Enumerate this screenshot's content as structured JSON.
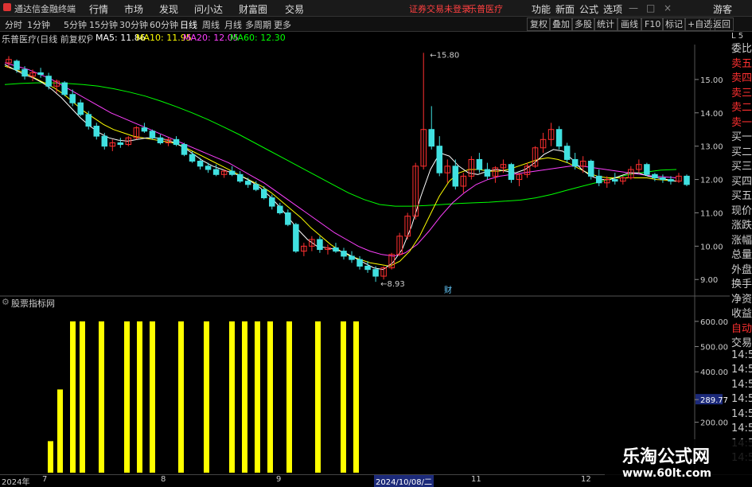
{
  "window": {
    "app_title": "通达信金融终端",
    "menus": [
      "行情",
      "市场",
      "发现",
      "问小达",
      "财富圈",
      "交易"
    ],
    "status_red": [
      "证券交易未登录",
      "乐普医疗"
    ],
    "right_menus": [
      "功能",
      "新面",
      "公式",
      "选项"
    ],
    "right_extra": "游客"
  },
  "toolbar": {
    "periods": [
      "分时",
      "1分钟",
      "5分钟",
      "15分钟",
      "30分钟",
      "60分钟",
      "日线",
      "周线",
      "月线",
      "多周期",
      "更多"
    ],
    "active": "日线",
    "right_buttons": [
      "复权",
      "叠加",
      "多股",
      "统计",
      "画线",
      "F10",
      "标记",
      "+自选",
      "返回"
    ]
  },
  "infobar": {
    "stock": "乐普医疗(日线 前复权)",
    "ma5": "MA5: 11.86",
    "ma10": "MA10: 11.95",
    "ma20": "MA20: 12.05",
    "ma60": "MA60: 12.30",
    "colors": {
      "ma5": "#ffffff",
      "ma10": "#ffff00",
      "ma20": "#ff40ff",
      "ma60": "#00ff00"
    }
  },
  "annotations": {
    "high": "15.80",
    "low": "8.93",
    "marker_cai": "财"
  },
  "price_axis": [
    "15.00",
    "14.00",
    "13.00",
    "12.00",
    "11.00",
    "10.00",
    "9.00"
  ],
  "indicator": {
    "title": "股票指标网",
    "axis": [
      "600.00",
      "500.00",
      "400.00",
      "289.77",
      "200.00"
    ],
    "current_label": "289.77"
  },
  "side_panel": {
    "top": "L 5",
    "items": [
      "委比",
      "卖五",
      "卖四",
      "卖三",
      "卖二",
      "卖一",
      "买一",
      "买二",
      "买三",
      "买四",
      "买五",
      "现价",
      "涨跌",
      "涨幅",
      "总量",
      "外盘",
      "换手",
      "净资",
      "收益",
      "自动",
      "交易",
      "14:5",
      "14:5",
      "14:5",
      "14:5",
      "14:5",
      "14:5",
      "14:5",
      "14:5"
    ]
  },
  "bottom_axis": {
    "labels": [
      "2024年",
      "7",
      "8",
      "9",
      "11",
      "12"
    ],
    "highlight": "2024/10/08/二"
  },
  "watermark": {
    "line1": "乐淘公式网",
    "line2": "www.60lt.com"
  },
  "chart_data": {
    "type": "candlestick",
    "price_range": [
      8.6,
      16.0
    ],
    "candles": [
      [
        15.5,
        15.7,
        15.35,
        15.6
      ],
      [
        15.55,
        15.6,
        15.2,
        15.3
      ],
      [
        15.3,
        15.4,
        15.0,
        15.1
      ],
      [
        15.1,
        15.3,
        14.95,
        15.2
      ],
      [
        15.2,
        15.35,
        15.05,
        15.15
      ],
      [
        15.1,
        15.2,
        14.7,
        14.8
      ],
      [
        14.8,
        15.0,
        14.6,
        14.95
      ],
      [
        14.9,
        14.95,
        14.5,
        14.55
      ],
      [
        14.55,
        14.7,
        14.2,
        14.3
      ],
      [
        14.3,
        14.4,
        13.9,
        13.95
      ],
      [
        13.95,
        14.05,
        13.5,
        13.6
      ],
      [
        13.6,
        13.7,
        13.2,
        13.3
      ],
      [
        13.3,
        13.4,
        12.9,
        13.0
      ],
      [
        13.0,
        13.2,
        12.85,
        13.1
      ],
      [
        13.1,
        13.25,
        12.95,
        13.05
      ],
      [
        13.05,
        13.3,
        13.0,
        13.25
      ],
      [
        13.25,
        13.6,
        13.2,
        13.55
      ],
      [
        13.55,
        13.7,
        13.4,
        13.45
      ],
      [
        13.45,
        13.5,
        13.2,
        13.25
      ],
      [
        13.25,
        13.35,
        13.05,
        13.1
      ],
      [
        13.1,
        13.25,
        13.0,
        13.2
      ],
      [
        13.2,
        13.3,
        13.0,
        13.05
      ],
      [
        13.05,
        13.1,
        12.7,
        12.75
      ],
      [
        12.75,
        12.85,
        12.5,
        12.55
      ],
      [
        12.55,
        12.65,
        12.3,
        12.4
      ],
      [
        12.4,
        12.5,
        12.2,
        12.3
      ],
      [
        12.3,
        12.45,
        12.1,
        12.15
      ],
      [
        12.15,
        12.3,
        12.05,
        12.25
      ],
      [
        12.25,
        12.4,
        12.1,
        12.15
      ],
      [
        12.15,
        12.25,
        11.9,
        11.95
      ],
      [
        11.95,
        12.05,
        11.75,
        11.85
      ],
      [
        11.85,
        11.95,
        11.65,
        11.7
      ],
      [
        11.7,
        11.8,
        11.4,
        11.45
      ],
      [
        11.45,
        11.55,
        11.1,
        11.2
      ],
      [
        11.2,
        11.3,
        10.95,
        11.0
      ],
      [
        11.0,
        11.1,
        10.6,
        10.65
      ],
      [
        10.65,
        10.7,
        9.8,
        9.85
      ],
      [
        9.85,
        10.1,
        9.7,
        10.0
      ],
      [
        10.0,
        10.3,
        9.85,
        10.2
      ],
      [
        10.2,
        10.3,
        9.8,
        9.9
      ],
      [
        9.9,
        10.05,
        9.75,
        9.95
      ],
      [
        9.95,
        10.1,
        9.8,
        9.85
      ],
      [
        9.85,
        9.95,
        9.6,
        9.7
      ],
      [
        9.7,
        9.85,
        9.5,
        9.6
      ],
      [
        9.6,
        9.7,
        9.3,
        9.4
      ],
      [
        9.4,
        9.55,
        9.2,
        9.3
      ],
      [
        9.3,
        9.4,
        8.93,
        9.1
      ],
      [
        9.1,
        9.4,
        9.0,
        9.35
      ],
      [
        9.35,
        9.8,
        9.3,
        9.75
      ],
      [
        9.75,
        10.4,
        9.7,
        10.3
      ],
      [
        10.3,
        11.0,
        10.2,
        10.9
      ],
      [
        10.9,
        12.5,
        10.8,
        12.4
      ],
      [
        12.4,
        15.8,
        12.3,
        13.5
      ],
      [
        13.5,
        14.2,
        12.9,
        13.0
      ],
      [
        13.0,
        13.3,
        12.1,
        12.2
      ],
      [
        12.2,
        12.6,
        11.9,
        12.4
      ],
      [
        12.4,
        12.6,
        11.7,
        11.8
      ],
      [
        11.8,
        12.2,
        11.6,
        12.1
      ],
      [
        12.1,
        12.7,
        12.0,
        12.6
      ],
      [
        12.6,
        12.8,
        12.2,
        12.3
      ],
      [
        12.3,
        12.5,
        12.0,
        12.1
      ],
      [
        12.1,
        12.4,
        11.9,
        12.35
      ],
      [
        12.35,
        12.6,
        12.2,
        12.45
      ],
      [
        12.45,
        12.5,
        11.9,
        12.0
      ],
      [
        12.0,
        12.2,
        11.8,
        12.15
      ],
      [
        12.15,
        12.5,
        12.05,
        12.4
      ],
      [
        12.4,
        13.0,
        12.35,
        12.95
      ],
      [
        12.95,
        13.4,
        12.8,
        13.2
      ],
      [
        13.2,
        13.7,
        13.0,
        13.5
      ],
      [
        13.5,
        13.6,
        12.9,
        13.0
      ],
      [
        13.0,
        13.1,
        12.5,
        12.6
      ],
      [
        12.6,
        12.8,
        12.3,
        12.4
      ],
      [
        12.4,
        12.7,
        12.2,
        12.55
      ],
      [
        12.55,
        12.6,
        12.0,
        12.1
      ],
      [
        12.1,
        12.3,
        11.8,
        11.9
      ],
      [
        11.9,
        12.1,
        11.75,
        12.0
      ],
      [
        12.0,
        12.2,
        11.85,
        11.95
      ],
      [
        11.95,
        12.1,
        11.85,
        12.05
      ],
      [
        12.05,
        12.4,
        12.0,
        12.3
      ],
      [
        12.3,
        12.6,
        12.2,
        12.45
      ],
      [
        12.45,
        12.5,
        12.1,
        12.15
      ],
      [
        12.15,
        12.2,
        11.95,
        12.05
      ],
      [
        12.05,
        12.15,
        11.9,
        12.0
      ],
      [
        12.0,
        12.1,
        11.85,
        11.95
      ],
      [
        11.95,
        12.2,
        11.9,
        12.1
      ],
      [
        12.1,
        12.15,
        11.8,
        11.85
      ]
    ],
    "ma": {
      "ma5": [
        15.45,
        15.3,
        15.15,
        15.05,
        14.9,
        14.7,
        14.45,
        14.15,
        13.85,
        13.6,
        13.4,
        13.25,
        13.18,
        13.15,
        13.2,
        13.25,
        13.25,
        13.2,
        13.1,
        12.95,
        12.75,
        12.55,
        12.4,
        12.3,
        12.2,
        12.1,
        11.95,
        11.75,
        11.5,
        11.2,
        10.85,
        10.5,
        10.2,
        10.0,
        9.95,
        9.9,
        9.8,
        9.65,
        9.5,
        9.35,
        9.3,
        9.5,
        9.9,
        10.6,
        11.5,
        12.3,
        12.8,
        12.7,
        12.4,
        12.2,
        12.15,
        12.25,
        12.3,
        12.25,
        12.2,
        12.3,
        12.5,
        12.75,
        12.9,
        12.85,
        12.6,
        12.3,
        12.1,
        12.0,
        12.0,
        12.1,
        12.2,
        12.2,
        12.1,
        12.05,
        12.0,
        11.95
      ],
      "ma10": [
        15.4,
        15.3,
        15.2,
        15.05,
        14.9,
        14.75,
        14.55,
        14.3,
        14.05,
        13.85,
        13.65,
        13.5,
        13.4,
        13.3,
        13.25,
        13.2,
        13.15,
        13.1,
        13.0,
        12.85,
        12.7,
        12.55,
        12.4,
        12.25,
        12.1,
        11.95,
        11.8,
        11.6,
        11.35,
        11.1,
        10.85,
        10.55,
        10.3,
        10.05,
        9.85,
        9.7,
        9.6,
        9.5,
        9.45,
        9.4,
        9.55,
        9.85,
        10.3,
        10.9,
        11.5,
        11.95,
        12.2,
        12.3,
        12.3,
        12.25,
        12.25,
        12.3,
        12.4,
        12.5,
        12.6,
        12.65,
        12.6,
        12.5,
        12.35,
        12.2,
        12.1,
        12.05,
        12.05,
        12.05,
        12.05,
        12.05,
        12.0,
        11.98,
        11.95
      ],
      "ma20": [
        15.5,
        15.4,
        15.3,
        15.15,
        15.0,
        14.8,
        14.6,
        14.4,
        14.2,
        14.0,
        13.85,
        13.7,
        13.55,
        13.4,
        13.25,
        13.1,
        12.95,
        12.8,
        12.65,
        12.5,
        12.3,
        12.1,
        11.9,
        11.65,
        11.4,
        11.15,
        10.9,
        10.65,
        10.4,
        10.2,
        10.0,
        9.85,
        9.75,
        9.7,
        9.8,
        10.05,
        10.45,
        10.9,
        11.3,
        11.6,
        11.85,
        12.0,
        12.1,
        12.15,
        12.2,
        12.25,
        12.3,
        12.35,
        12.4,
        12.4,
        12.35,
        12.3,
        12.25,
        12.2,
        12.15,
        12.1,
        12.08,
        12.05
      ],
      "ma60": [
        14.85,
        14.88,
        14.9,
        14.9,
        14.88,
        14.85,
        14.8,
        14.72,
        14.62,
        14.5,
        14.35,
        14.18,
        14.0,
        13.8,
        13.58,
        13.35,
        13.1,
        12.85,
        12.6,
        12.35,
        12.1,
        11.85,
        11.6,
        11.4,
        11.25,
        11.2,
        11.2,
        11.22,
        11.25,
        11.28,
        11.3,
        11.32,
        11.35,
        11.38,
        11.45,
        11.55,
        11.68,
        11.8,
        11.92,
        12.05,
        12.15,
        12.22,
        12.28,
        12.3
      ]
    },
    "indicator_bars": [
      {
        "i": 14,
        "v": 125
      },
      {
        "i": 17,
        "v": 330
      },
      {
        "i": 21,
        "v": 600
      },
      {
        "i": 24,
        "v": 600
      },
      {
        "i": 30,
        "v": 600
      },
      {
        "i": 38,
        "v": 600
      },
      {
        "i": 42,
        "v": 600
      },
      {
        "i": 46,
        "v": 600
      },
      {
        "i": 55,
        "v": 600
      },
      {
        "i": 63,
        "v": 600
      },
      {
        "i": 71,
        "v": 600
      },
      {
        "i": 75,
        "v": 600
      },
      {
        "i": 79,
        "v": 600
      },
      {
        "i": 83,
        "v": 600
      },
      {
        "i": 89,
        "v": 600
      },
      {
        "i": 98,
        "v": 600
      },
      {
        "i": 106,
        "v": 600
      },
      {
        "i": 110,
        "v": 600
      }
    ],
    "indicator_range": [
      0,
      650
    ]
  }
}
